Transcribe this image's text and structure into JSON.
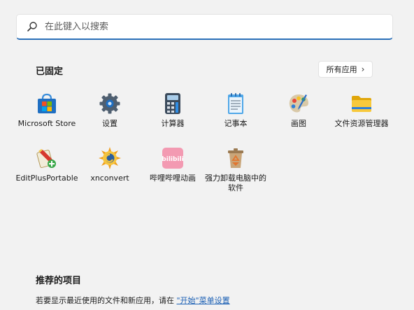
{
  "search": {
    "placeholder": "在此键入以搜索",
    "icon": "search-icon"
  },
  "pinned": {
    "title": "已固定",
    "all_apps_label": "所有应用",
    "apps": [
      {
        "label": "Microsoft Store",
        "icon": "microsoft-store-icon"
      },
      {
        "label": "设置",
        "icon": "settings-gear-icon"
      },
      {
        "label": "计算器",
        "icon": "calculator-icon"
      },
      {
        "label": "记事本",
        "icon": "notepad-icon"
      },
      {
        "label": "画图",
        "icon": "paint-palette-icon"
      },
      {
        "label": "文件资源管理器",
        "icon": "folder-icon"
      },
      {
        "label": "EditPlusPortable",
        "icon": "editplus-icon"
      },
      {
        "label": "xnconvert",
        "icon": "xnconvert-icon"
      },
      {
        "label": "哔哩哔哩动画",
        "icon": "bilibili-icon"
      },
      {
        "label": "强力卸载电脑中的软件",
        "icon": "uninstaller-recycle-icon"
      }
    ]
  },
  "recommended": {
    "title": "推荐的项目",
    "text_prefix": "若要显示最近使用的文件和新应用，请在",
    "link_text": "\"开始\"菜单设置"
  },
  "colors": {
    "accent": "#2a6fb8",
    "background": "#f2f2f2"
  }
}
